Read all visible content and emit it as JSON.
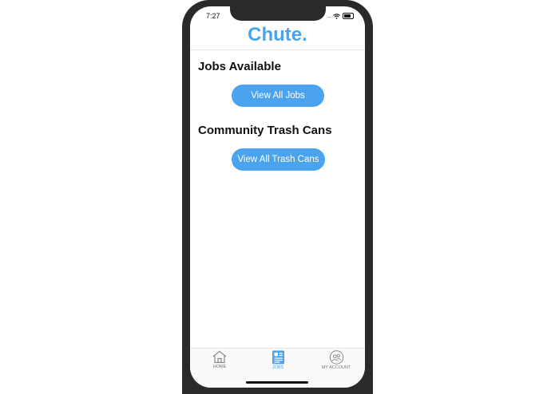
{
  "status_bar": {
    "time": "7:27",
    "signal_dots": "....",
    "icons": [
      "wifi-icon",
      "battery-icon"
    ]
  },
  "header": {
    "app_title": "Chute."
  },
  "sections": [
    {
      "heading": "Jobs Available",
      "button_label": "View All Jobs"
    },
    {
      "heading": "Community Trash Cans",
      "button_label": "View All Trash Cans"
    }
  ],
  "tabbar": {
    "tabs": [
      {
        "label": "HOME",
        "icon": "home-icon",
        "active": false
      },
      {
        "label": "JOBS",
        "icon": "jobs-icon",
        "active": true
      },
      {
        "label": "MY ACCOUNT",
        "icon": "account-icon",
        "active": false
      }
    ]
  },
  "colors": {
    "accent": "#4aa3ee",
    "phone_frame": "#2a2a2a",
    "inactive_tab": "#777777"
  }
}
